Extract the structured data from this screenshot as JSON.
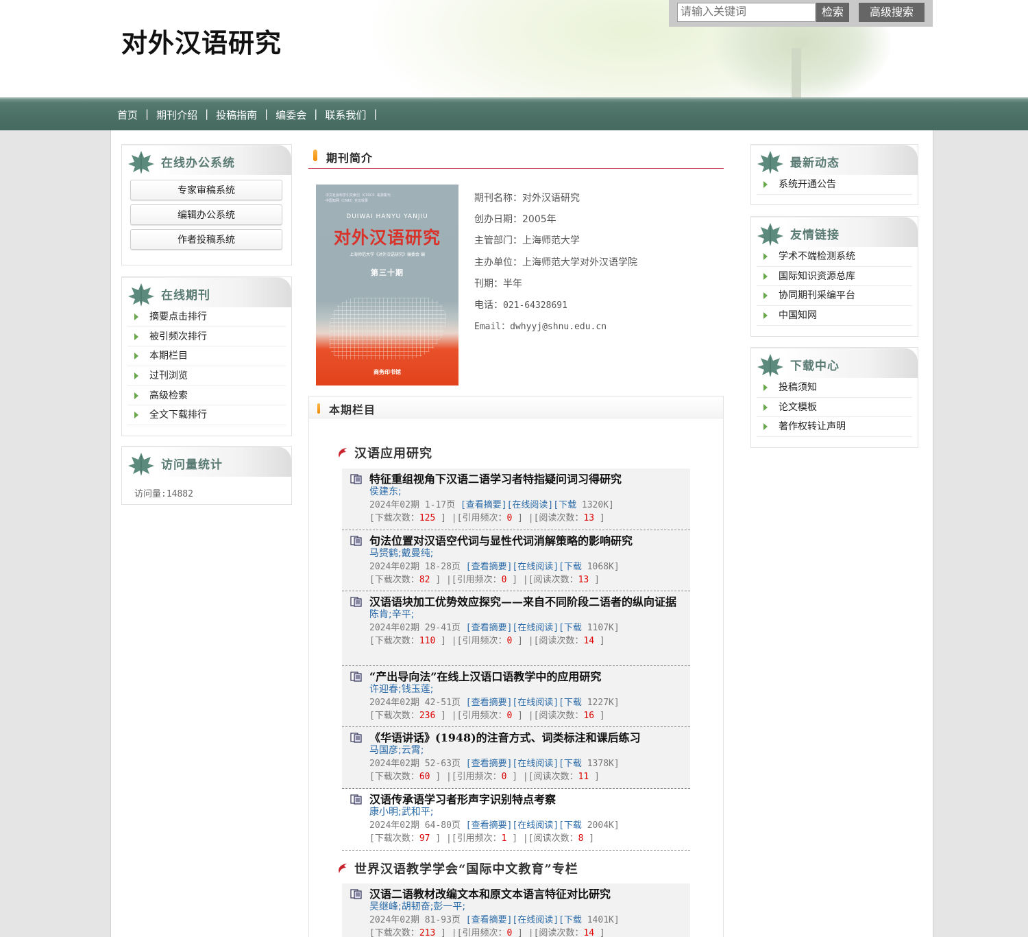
{
  "header": {
    "site_title": "对外汉语研究",
    "search_placeholder": "请输入关键词",
    "search_button": "检索",
    "advanced_button": "高级搜索"
  },
  "nav": [
    "首页",
    "期刊介绍",
    "投稿指南",
    "编委会",
    "联系我们"
  ],
  "nav_separator": "|",
  "left": {
    "office": {
      "title": "在线办公系统",
      "buttons": [
        "专家审稿系统",
        "编辑办公系统",
        "作者投稿系统"
      ]
    },
    "journal": {
      "title": "在线期刊",
      "items": [
        "摘要点击排行",
        "被引频次排行",
        "本期栏目",
        "过刊浏览",
        "高级检索",
        "全文下载排行"
      ]
    },
    "visits": {
      "title": "访问量统计",
      "text": "访问量:14882"
    }
  },
  "main": {
    "intro_title": "期刊简介",
    "cover": {
      "top_line1": "中文社会科学引文索引（CSSCI）来源集刊",
      "top_line2": "中国知网（CNKI）全文收录",
      "pinyin": "DUIWAI HANYU YANJIU",
      "title": "对外汉语研究",
      "editor": "上海师范大学《对外汉语研究》编委会 编",
      "issue": "第三十期",
      "publisher": "商务印书馆"
    },
    "info": [
      {
        "label": "期刊名称：",
        "value": "对外汉语研究"
      },
      {
        "label": "创办日期：",
        "value": "2005年"
      },
      {
        "label": "主管部门：",
        "value": "上海师范大学"
      },
      {
        "label": "主办单位：",
        "value": "上海师范大学对外汉语学院"
      },
      {
        "label": "刊期：",
        "value": "半年"
      },
      {
        "label": "电话：",
        "value": "021-64328691"
      },
      {
        "label": "Email：",
        "value": "dwhyyj@shnu.edu.cn"
      }
    ],
    "issue_title": "本期栏目",
    "section1": "汉语应用研究",
    "section2": "世界汉语教学学会“国际中文教育”专栏",
    "labels": {
      "abstract": "[查看摘要]",
      "read": "[在线阅读]",
      "download": "[下载",
      "dl_count": "[下载次数：",
      "cite_count": "[引用频次：",
      "read_count": "[阅读次数：",
      "close": "]"
    },
    "articles": [
      {
        "title": "特征重组视角下汉语二语学习者特指疑问词习得研究",
        "authors": "侯建东;",
        "issue": "2024年02期",
        "pages": "1-17页",
        "size": "1320K]",
        "downloads": "125",
        "cites": "0",
        "reads": "13"
      },
      {
        "title": "句法位置对汉语空代词与显性代词消解策略的影响研究",
        "authors": "马赟鹤;戴曼纯;",
        "issue": "2024年02期",
        "pages": "18-28页",
        "size": "1068K]",
        "downloads": "82",
        "cites": "0",
        "reads": "13"
      },
      {
        "title": "汉语语块加工优势效应探究——来自不同阶段二语者的纵向证据",
        "authors": "陈肯;辛平;",
        "issue": "2024年02期",
        "pages": "29-41页",
        "size": "1107K]",
        "downloads": "110",
        "cites": "0",
        "reads": "14"
      },
      {
        "title": "“产出导向法”在线上汉语口语教学中的应用研究",
        "authors": "许迎春;钱玉莲;",
        "issue": "2024年02期",
        "pages": "42-51页",
        "size": "1227K]",
        "downloads": "236",
        "cites": "0",
        "reads": "16"
      },
      {
        "title": "《华语讲话》(1948)的注音方式、词类标注和课后练习",
        "authors": "马国彦;云霄;",
        "issue": "2024年02期",
        "pages": "52-63页",
        "size": "1378K]",
        "downloads": "60",
        "cites": "0",
        "reads": "11"
      },
      {
        "title": "汉语传承语学习者形声字识别特点考察",
        "authors": "康小明;武和平;",
        "issue": "2024年02期",
        "pages": "64-80页",
        "size": "2004K]",
        "downloads": "97",
        "cites": "1",
        "reads": "8"
      },
      {
        "title": "汉语二语教材改编文本和原文本语言特征对比研究",
        "authors": "吴继峰;胡韧奋;彭一平;",
        "issue": "2024年02期",
        "pages": "81-93页",
        "size": "1401K]",
        "downloads": "213",
        "cites": "0",
        "reads": "14"
      }
    ]
  },
  "right": {
    "news": {
      "title": "最新动态",
      "items": [
        "系统开通公告"
      ]
    },
    "links": {
      "title": "友情链接",
      "items": [
        "学术不端检测系统",
        "国际知识资源总库",
        "协同期刊采编平台",
        "中国知网"
      ]
    },
    "downloads": {
      "title": "下载中心",
      "items": [
        "投稿须知",
        "论文模板",
        "著作权转让声明"
      ]
    }
  },
  "colors": {
    "nav_bg": "#4c7166",
    "accent_red": "#c8364a",
    "link_blue": "#2a6aa8",
    "count_red": "#dd0000",
    "leaf_green": "#5a7b73"
  }
}
